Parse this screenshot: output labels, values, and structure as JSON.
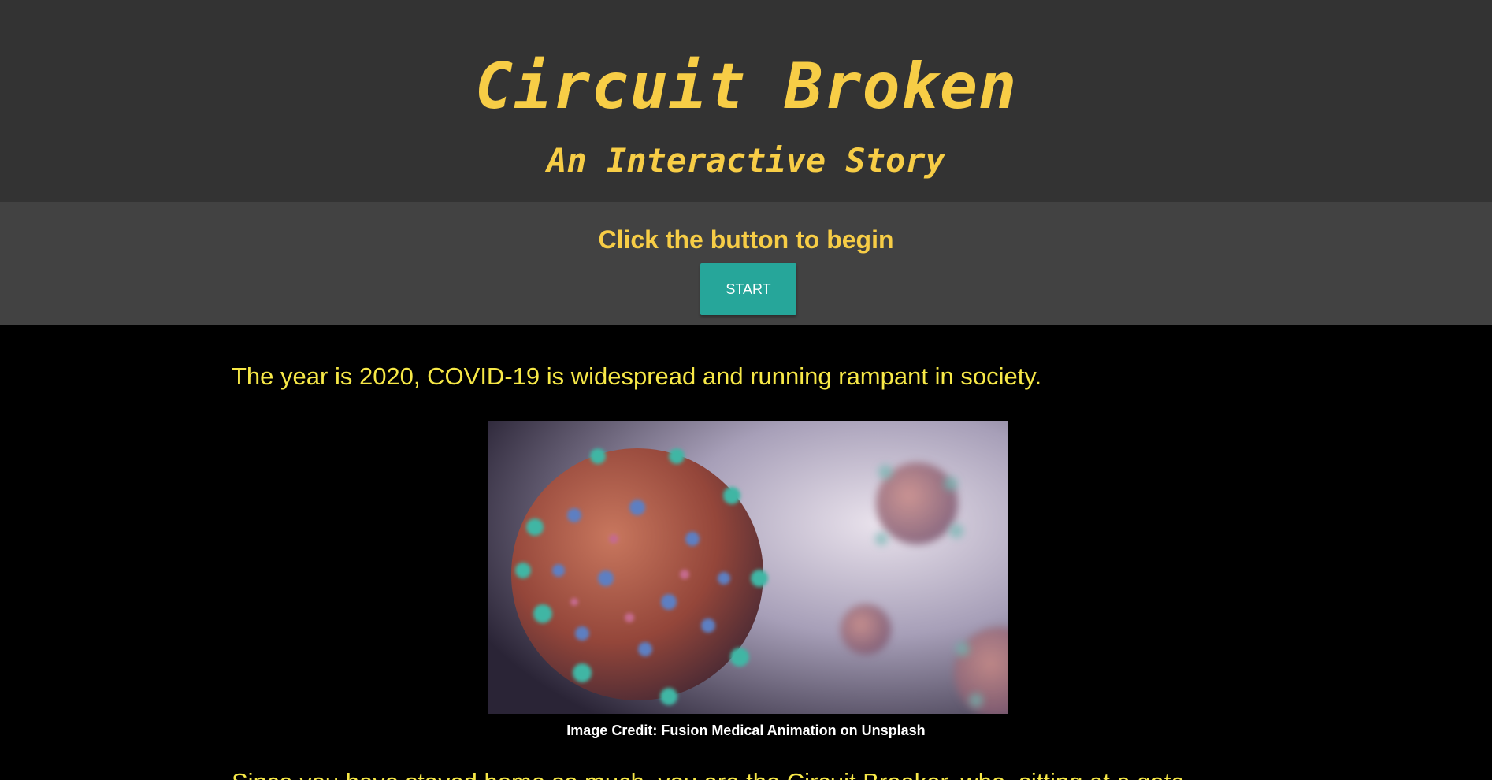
{
  "header": {
    "title": "Circuit Broken",
    "subtitle": "An Interactive Story"
  },
  "start": {
    "prompt": "Click the button to begin",
    "button_label": "START"
  },
  "story": {
    "intro": "The year is 2020, COVID-19 is widespread and running rampant in society.",
    "image_credit": "Image Credit: Fusion Medical Animation on Unsplash",
    "next_line": "Since you have stayed home so much, you are the Circuit Breaker, who, sitting at a gate"
  },
  "colors": {
    "accent_yellow": "#f7cd46",
    "story_text": "#f7e847",
    "button_teal": "#26a69a",
    "header_bg": "#333333",
    "band_bg": "#424242",
    "page_bg": "#000000"
  },
  "icons": {
    "image": "coronavirus-illustration"
  }
}
